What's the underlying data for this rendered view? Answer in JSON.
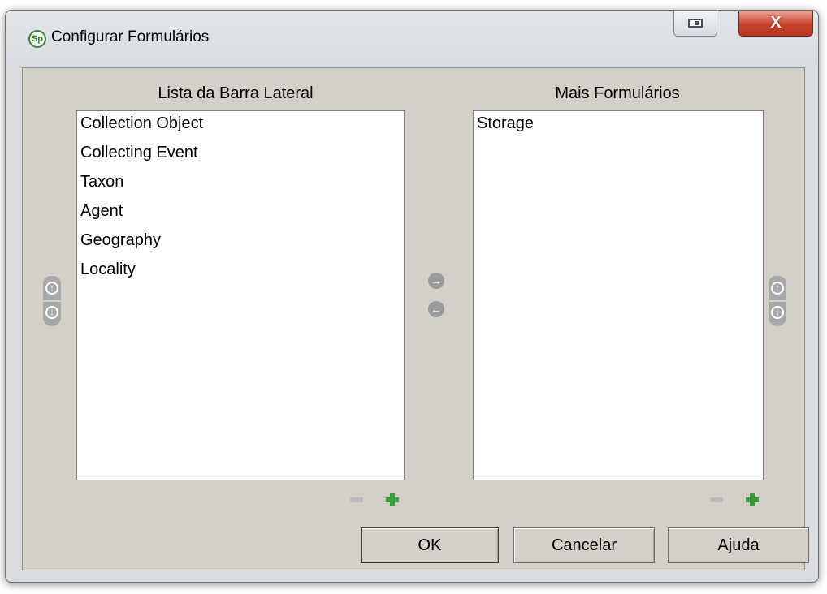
{
  "window": {
    "title": "Configurar Formulários",
    "app_icon_text": "Sp",
    "close_glyph": "X"
  },
  "left_panel": {
    "header": "Lista da Barra Lateral",
    "items": [
      "Collection Object",
      "Collecting Event",
      "Taxon",
      "Agent",
      "Geography",
      "Locality"
    ]
  },
  "right_panel": {
    "header": "Mais Formulários",
    "items": [
      "Storage"
    ]
  },
  "icons": {
    "move_right": "arrow-right-icon",
    "move_left": "arrow-left-icon",
    "move_up": "arrow-up-icon",
    "move_down": "arrow-down-icon",
    "remove": "minus-icon",
    "add": "plus-icon",
    "arrow_right_glyph": "→",
    "arrow_left_glyph": "←",
    "arrow_up_glyph": "↑",
    "arrow_down_glyph": "↓"
  },
  "buttons": {
    "ok": "OK",
    "cancel": "Cancelar",
    "help": "Ajuda"
  },
  "colors": {
    "dialog_background": "#d4d0c8",
    "close_button": "#c9402a",
    "add_icon": "#3b9a3b"
  }
}
